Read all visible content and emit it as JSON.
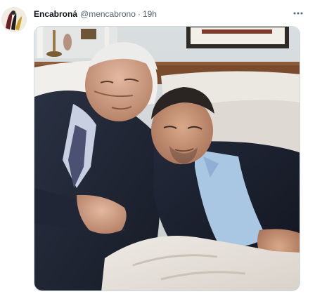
{
  "tweet": {
    "display_name": "Encabroná",
    "handle": "@mencabrono",
    "separator": "·",
    "time": "19h"
  },
  "colors": {
    "name": "#0f1419",
    "meta": "#536471",
    "border": "#cfd9de"
  },
  "icons": {
    "more": "more-horizontal-icon"
  }
}
